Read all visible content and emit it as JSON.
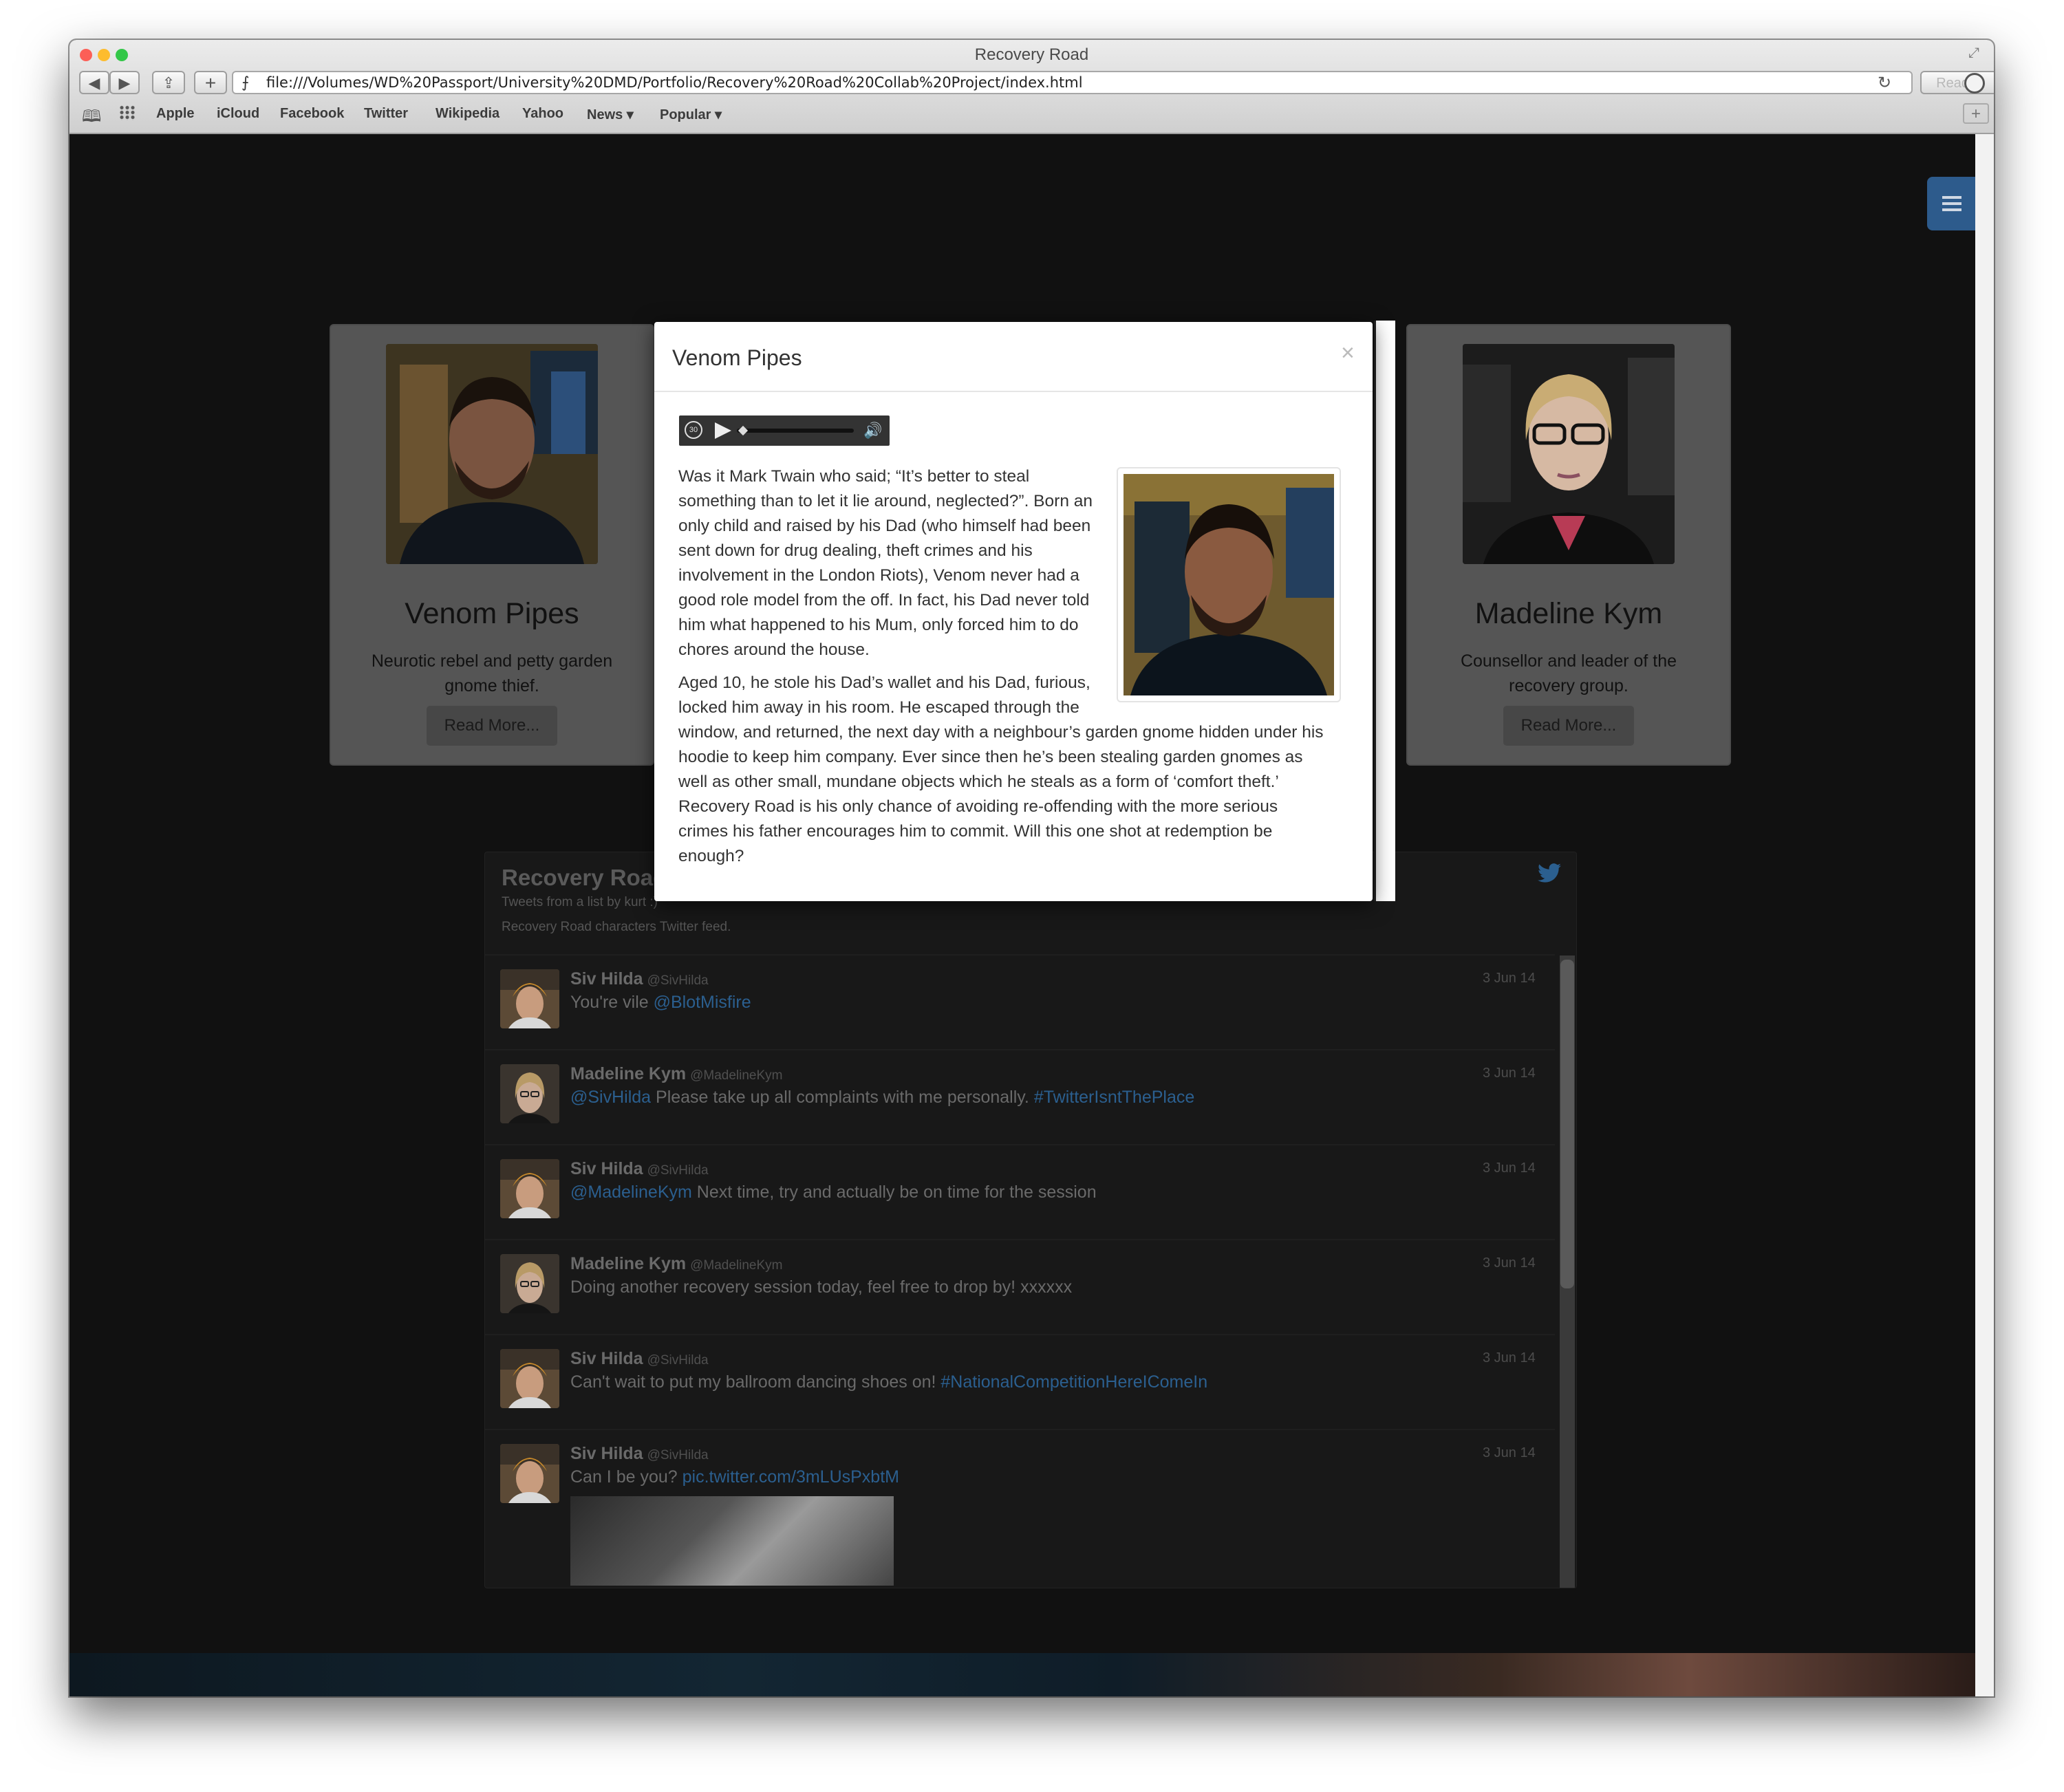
{
  "browser": {
    "title": "Recovery Road",
    "url": "file:///Volumes/WD%20Passport/University%20DMD/Portfolio/Recovery%20Road%20Collab%20Project/index.html",
    "reader_label": "Reader",
    "bookmarks": [
      "Apple",
      "iCloud",
      "Facebook",
      "Twitter",
      "Wikipedia",
      "Yahoo",
      "News ▾",
      "Popular ▾"
    ],
    "traffic_colors": [
      "#fc5f57",
      "#fdbc2e",
      "#33c748"
    ]
  },
  "cards": [
    {
      "name": "Venom Pipes",
      "description": "Neurotic rebel and petty garden gnome thief.",
      "button": "Read More..."
    },
    {
      "name": "Madeline Kym",
      "description": "Counsellor and leader of the recovery group.",
      "button": "Read More..."
    }
  ],
  "modal": {
    "title": "Venom Pipes",
    "close": "×",
    "audio_skip_label": "30",
    "paragraph1_lines": [
      "Was it Mark Twain who said; “It’s better to steal",
      "something than to let it lie around, neglected?”. Born an",
      "only child and raised by his Dad (who himself had been",
      "sent down for drug dealing, theft crimes and his",
      "involvement in the London Riots), Venom never had a",
      "good role model from the off. In fact, his Dad never told",
      "him what happened to his Mum, only forced him to do",
      "chores around the house."
    ],
    "paragraph2_lines": [
      "Aged 10, he stole his Dad’s wallet and his Dad, furious,",
      "locked him away in his room. He escaped through the",
      "window, and returned, the next day with a neighbour’s garden gnome hidden under his",
      "hoodie to keep him company. Ever since then he’s been stealing garden gnomes as",
      "well as other small, mundane objects which he steals as a form of ‘comfort theft.’",
      "Recovery Road is his only chance of avoiding re-offending with the more serious",
      "crimes his father encourages him to commit. Will this one shot at redemption be",
      "enough?"
    ]
  },
  "twitter": {
    "title": "Recovery Road",
    "subtitle": "Tweets from a list by kurt :)",
    "description": "Recovery Road characters Twitter feed.",
    "tweets": [
      {
        "name": "Siv Hilda",
        "handle": "@SivHilda",
        "date": "3 Jun 14",
        "pre": "You're vile ",
        "link": "@BlotMisfire",
        "post": "",
        "link2": "",
        "avatar": "hilda"
      },
      {
        "name": "Madeline Kym",
        "handle": "@MadelineKym",
        "date": "3 Jun 14",
        "pre": "",
        "link": "@SivHilda",
        "post": " Please take up all complaints with me personally. ",
        "link2": "#TwitterIsntThePlace",
        "avatar": "kym"
      },
      {
        "name": "Siv Hilda",
        "handle": "@SivHilda",
        "date": "3 Jun 14",
        "pre": "",
        "link": "@MadelineKym",
        "post": " Next time, try and actually be on time for the session",
        "link2": "",
        "avatar": "hilda"
      },
      {
        "name": "Madeline Kym",
        "handle": "@MadelineKym",
        "date": "3 Jun 14",
        "pre": "Doing another recovery session today, feel free to drop by! xxxxxx",
        "link": "",
        "post": "",
        "link2": "",
        "avatar": "kym"
      },
      {
        "name": "Siv Hilda",
        "handle": "@SivHilda",
        "date": "3 Jun 14",
        "pre": "Can't wait to put my ballroom dancing shoes on! ",
        "link": "#NationalCompetitionHereIComeIn",
        "post": "",
        "link2": "",
        "avatar": "hilda"
      },
      {
        "name": "Siv Hilda",
        "handle": "@SivHilda",
        "date": "3 Jun 14",
        "pre": "Can I be you? ",
        "link": "pic.twitter.com/3mLUsPxbtM",
        "post": "",
        "link2": "",
        "avatar": "hilda"
      }
    ]
  },
  "colors": {
    "accent_blue": "#2d5b8c",
    "link": "#2b5f8f",
    "page_bg": "#111111",
    "card_bg": "#555555"
  }
}
